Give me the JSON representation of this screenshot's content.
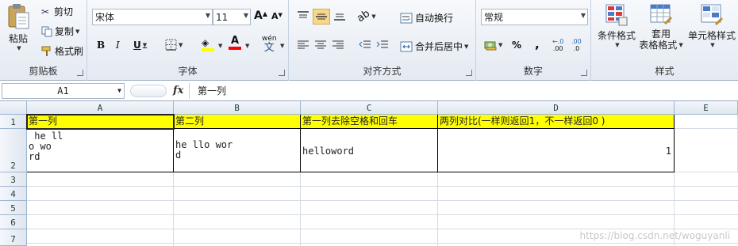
{
  "ribbon": {
    "clipboard": {
      "paste": "粘贴",
      "cut": "剪切",
      "copy": "复制",
      "format_painter": "格式刷",
      "label": "剪贴板"
    },
    "font": {
      "name": "宋体",
      "size": "11",
      "grow": "A",
      "shrink": "A",
      "bold": "B",
      "italic": "I",
      "underline": "U",
      "wen": "wén",
      "wen_char": "文",
      "color_letter": "A",
      "label": "字体"
    },
    "alignment": {
      "wrap": "自动换行",
      "merge": "合并后居中",
      "label": "对齐方式"
    },
    "number": {
      "format": "常规",
      "percent": "%",
      "comma": ",",
      "inc_decimal": ".00",
      "dec_decimal": ".0",
      "label": "数字"
    },
    "styles": {
      "conditional": "条件格式",
      "table_line1": "套用",
      "table_line2": "表格格式",
      "cell_styles": "单元格样式",
      "label": "样式"
    },
    "colors": {
      "highlight": "#ffff00",
      "font_color": "#ff0000"
    }
  },
  "formula_bar": {
    "name_box": "A1",
    "fx": "fx",
    "content": "第一列"
  },
  "grid": {
    "columns": [
      "A",
      "B",
      "C",
      "D",
      "E"
    ],
    "rows": [
      "1",
      "2",
      "3",
      "4",
      "5",
      "6",
      "7"
    ],
    "row1": [
      "第一列",
      "第二列",
      "第一列去除空格和回车",
      "两列对比(一样则返回1，不一样返回0 )"
    ],
    "row2": [
      " he ll\no wo\nrd",
      "he llo wor\nd",
      "helloword",
      "1"
    ],
    "highlight_color": "#ffff00"
  },
  "watermark": "https://blog.csdn.net/woguyanli"
}
